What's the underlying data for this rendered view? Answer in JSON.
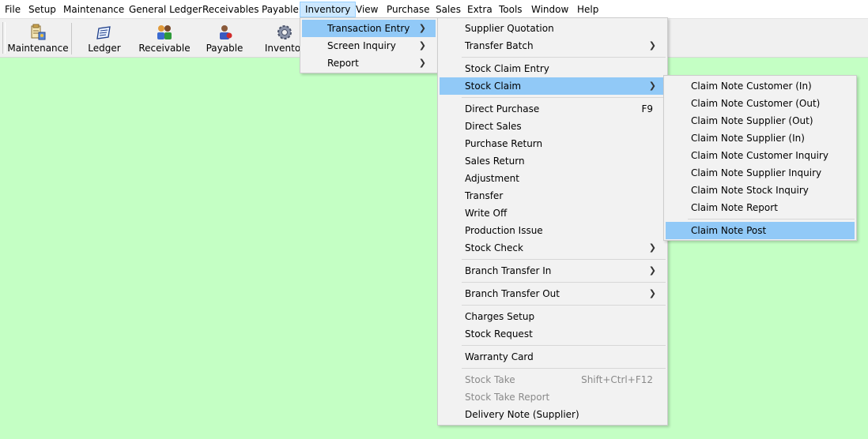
{
  "menubar": {
    "items": [
      "File",
      "Setup",
      "Maintenance",
      "General Ledger",
      "Receivables",
      "Payable",
      "Inventory",
      "View",
      "Purchase",
      "Sales",
      "Extra",
      "Tools",
      "Window",
      "Help"
    ],
    "active": "Inventory"
  },
  "toolbar": {
    "buttons": [
      {
        "label": "Maintenance",
        "icon": "maintenance-icon"
      },
      {
        "label": "Ledger",
        "icon": "ledger-icon"
      },
      {
        "label": "Receivable",
        "icon": "receivable-icon"
      },
      {
        "label": "Payable",
        "icon": "payable-icon"
      },
      {
        "label": "Inventor",
        "icon": "inventory-gear-icon"
      }
    ]
  },
  "inventory_menu": {
    "items": [
      {
        "label": "Transaction Entry",
        "submenu": true,
        "highlighted": true
      },
      {
        "label": "Screen Inquiry",
        "submenu": true
      },
      {
        "label": "Report",
        "submenu": true
      }
    ]
  },
  "transaction_menu": {
    "items": [
      {
        "label": "Supplier Quotation"
      },
      {
        "label": "Transfer Batch",
        "submenu": true
      },
      {
        "label": "Stock Claim Entry"
      },
      {
        "label": "Stock Claim",
        "submenu": true,
        "highlighted": true
      },
      {
        "label": "Direct Purchase",
        "shortcut": "F9"
      },
      {
        "label": "Direct Sales"
      },
      {
        "label": "Purchase Return"
      },
      {
        "label": "Sales Return"
      },
      {
        "label": "Adjustment"
      },
      {
        "label": "Transfer"
      },
      {
        "label": "Write Off"
      },
      {
        "label": "Production Issue"
      },
      {
        "label": "Stock Check",
        "submenu": true
      },
      {
        "label": "Branch Transfer In",
        "submenu": true
      },
      {
        "label": "Branch Transfer Out",
        "submenu": true
      },
      {
        "label": "Charges Setup"
      },
      {
        "label": "Stock Request"
      },
      {
        "label": "Warranty Card"
      },
      {
        "label": "Stock Take",
        "shortcut": "Shift+Ctrl+F12",
        "disabled": true
      },
      {
        "label": "Stock Take Report",
        "disabled": true
      },
      {
        "label": "Delivery Note (Supplier)"
      }
    ]
  },
  "stock_claim_menu": {
    "items": [
      {
        "label": "Claim Note Customer (In)"
      },
      {
        "label": "Claim Note Customer (Out)"
      },
      {
        "label": "Claim Note Supplier (Out)"
      },
      {
        "label": "Claim Note Supplier (In)"
      },
      {
        "label": "Claim Note Customer Inquiry"
      },
      {
        "label": "Claim Note Supplier Inquiry"
      },
      {
        "label": "Claim Note Stock Inquiry"
      },
      {
        "label": "Claim Note Report"
      },
      {
        "label": "Claim Note Post",
        "highlighted": true
      }
    ]
  },
  "colors": {
    "workspace": "#c4ffc4",
    "highlight": "#91c9f7",
    "menubar_active": "#cce8ff"
  }
}
